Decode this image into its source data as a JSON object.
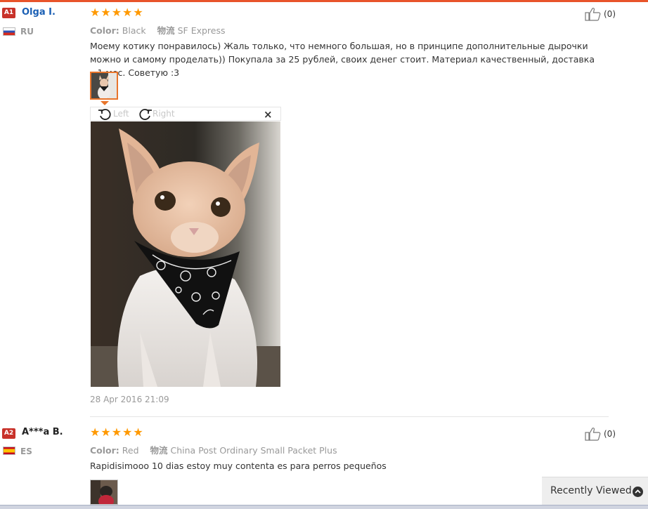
{
  "reviews": [
    {
      "badge": "A1",
      "name": "Olga I.",
      "name_color": "#1a5fb4",
      "country": "RU",
      "stars": "★★★★★",
      "color_label": "Color:",
      "color_value": "Black",
      "shipping_label": "物流",
      "shipping_value": "SF Express",
      "text": "Моему котику понравилось) Жаль только, что немного большая, но в принципе дополнительные дырочки можно и самому проделать)) Покупала за 25 рублей, своих денег стоит. Материал качественный, доставка ~1 мес. Советую :3",
      "likes": "(0)",
      "date": "28 Apr 2016 21:09"
    },
    {
      "badge": "A2",
      "name": "A***a B.",
      "name_color": "#222222",
      "country": "ES",
      "stars": "★★★★★",
      "color_label": "Color:",
      "color_value": "Red",
      "shipping_label": "物流",
      "shipping_value": "China Post Ordinary Small Packet Plus",
      "text": "Rapidisimooo 10 dias estoy muy contenta es para perros pequeños",
      "likes": "(0)"
    }
  ],
  "viewer": {
    "rotate_left_label": "Left",
    "rotate_right_label": "Right",
    "close_label": "×"
  },
  "recently_viewed": {
    "label": "Recently Viewed"
  },
  "colors": {
    "accent": "#e8542a",
    "star": "#ff9900",
    "badge": "#c8322a"
  }
}
